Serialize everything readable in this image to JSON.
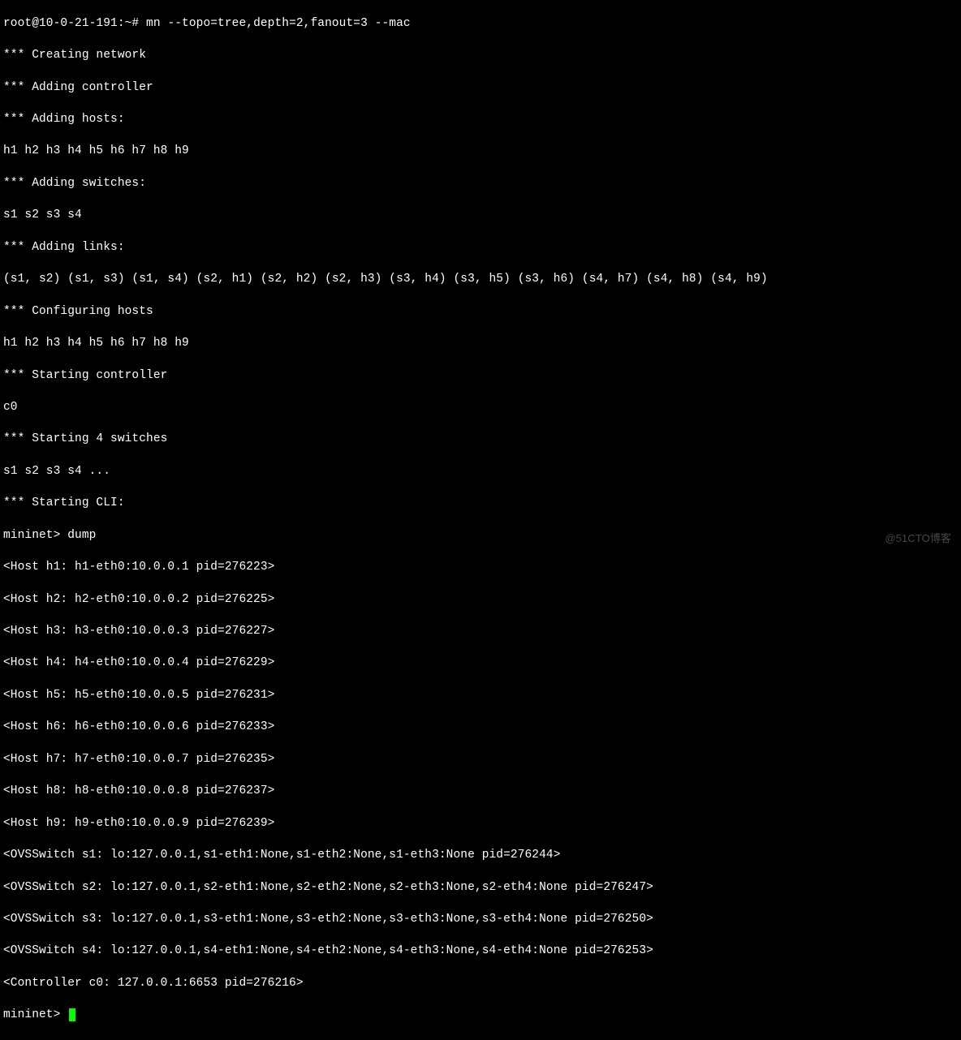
{
  "prompt1_user": "root@10-0-21-191:~#",
  "prompt1_cmd": "mn --topo=tree,depth=2,fanout=3 --mac",
  "msg_creating": "*** Creating network",
  "msg_addctrl": "*** Adding controller",
  "msg_addhosts": "*** Adding hosts:",
  "hosts_list": "h1 h2 h3 h4 h5 h6 h7 h8 h9",
  "msg_addsw": "*** Adding switches:",
  "switches_list": "s1 s2 s3 s4",
  "msg_addlinks": "*** Adding links:",
  "links_list": "(s1, s2) (s1, s3) (s1, s4) (s2, h1) (s2, h2) (s2, h3) (s3, h4) (s3, h5) (s3, h6) (s4, h7) (s4, h8) (s4, h9)",
  "msg_confhosts": "*** Configuring hosts",
  "conf_hosts_list": "h1 h2 h3 h4 h5 h6 h7 h8 h9",
  "msg_startctrl": "*** Starting controller",
  "ctrl_list": "c0",
  "msg_startsw": "*** Starting 4 switches",
  "startsw_list": "s1 s2 s3 s4 ...",
  "msg_startcli": "*** Starting CLI:",
  "prompt2_prefix": "mininet>",
  "prompt2_cmd": "dump",
  "dump": {
    "h1": "<Host h1: h1-eth0:10.0.0.1 pid=276223>",
    "h2": "<Host h2: h2-eth0:10.0.0.2 pid=276225>",
    "h3": "<Host h3: h3-eth0:10.0.0.3 pid=276227>",
    "h4": "<Host h4: h4-eth0:10.0.0.4 pid=276229>",
    "h5": "<Host h5: h5-eth0:10.0.0.5 pid=276231>",
    "h6": "<Host h6: h6-eth0:10.0.0.6 pid=276233>",
    "h7": "<Host h7: h7-eth0:10.0.0.7 pid=276235>",
    "h8": "<Host h8: h8-eth0:10.0.0.8 pid=276237>",
    "h9": "<Host h9: h9-eth0:10.0.0.9 pid=276239>",
    "s1": "<OVSSwitch s1: lo:127.0.0.1,s1-eth1:None,s1-eth2:None,s1-eth3:None pid=276244>",
    "s2": "<OVSSwitch s2: lo:127.0.0.1,s2-eth1:None,s2-eth2:None,s2-eth3:None,s2-eth4:None pid=276247>",
    "s3": "<OVSSwitch s3: lo:127.0.0.1,s3-eth1:None,s3-eth2:None,s3-eth3:None,s3-eth4:None pid=276250>",
    "s4": "<OVSSwitch s4: lo:127.0.0.1,s4-eth1:None,s4-eth2:None,s4-eth3:None,s4-eth4:None pid=276253>",
    "c0": "<Controller c0: 127.0.0.1:6653 pid=276216>"
  },
  "prompt3_prefix": "mininet>",
  "watermark": "@51CTO博客"
}
